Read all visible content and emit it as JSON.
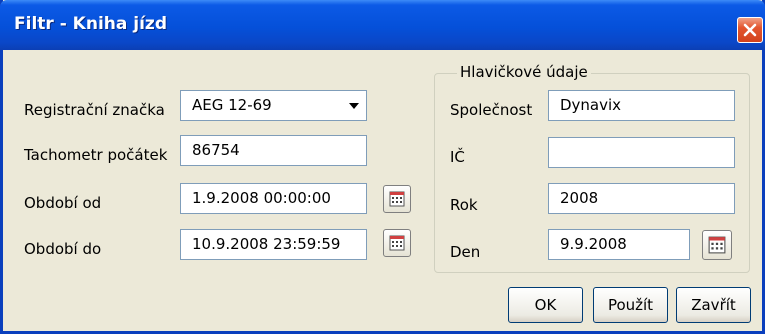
{
  "window": {
    "title": "Filtr - Kniha jízd"
  },
  "form": {
    "registration": {
      "label": "Registrační značka",
      "value": "AEG 12-69"
    },
    "odometer": {
      "label": "Tachometr počátek",
      "value": "86754"
    },
    "period_from": {
      "label": "Období od",
      "value": "1.9.2008 00:00:00"
    },
    "period_to": {
      "label": "Období do",
      "value": "10.9.2008 23:59:59"
    }
  },
  "header_group": {
    "title": "Hlavičkové údaje",
    "company": {
      "label": "Společnost",
      "value": "Dynavix"
    },
    "ic": {
      "label": "IČ",
      "value": ""
    },
    "year": {
      "label": "Rok",
      "value": "2008"
    },
    "day": {
      "label": "Den",
      "value": "9.9.2008"
    }
  },
  "buttons": {
    "ok": "OK",
    "apply": "Použít",
    "close": "Zavřít"
  },
  "colors": {
    "titlebar": "#0550d9",
    "close_button": "#e3562f",
    "window_bg": "#ece9d8"
  }
}
